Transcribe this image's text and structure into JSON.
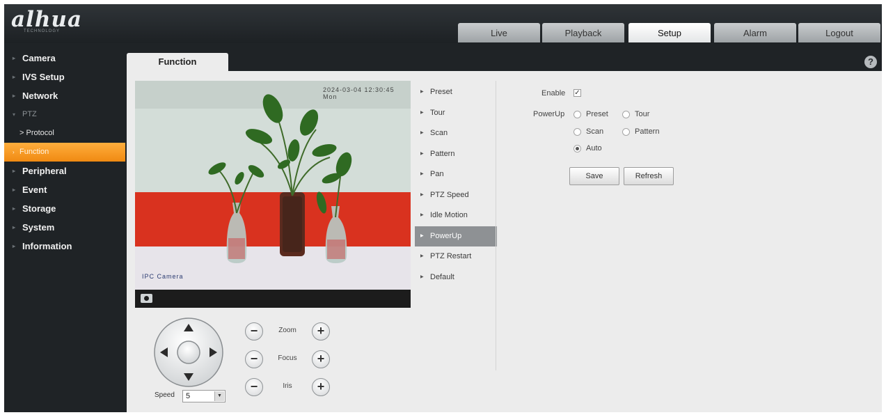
{
  "brand": {
    "logo": "alhua",
    "tagline": "TECHNOLOGY"
  },
  "nav_tabs": [
    {
      "label": "Live",
      "active": false
    },
    {
      "label": "Playback",
      "active": false
    },
    {
      "label": "Setup",
      "active": true
    },
    {
      "label": "Alarm",
      "active": false
    },
    {
      "label": "Logout",
      "active": false
    }
  ],
  "sidebar": {
    "items": [
      {
        "label": "Camera"
      },
      {
        "label": "IVS Setup"
      },
      {
        "label": "Network"
      },
      {
        "label": "PTZ"
      },
      {
        "label": "> Protocol"
      },
      {
        "label": "Function",
        "selected": true
      },
      {
        "label": "Peripheral"
      },
      {
        "label": "Event"
      },
      {
        "label": "Storage"
      },
      {
        "label": "System"
      },
      {
        "label": "Information"
      }
    ]
  },
  "content": {
    "tab_label": "Function",
    "help_icon": "?"
  },
  "video": {
    "osd_time": "2024-03-04 12:30:45 Mon",
    "osd_name": "IPC Camera"
  },
  "ptz": {
    "speed_label": "Speed",
    "speed_value": "5",
    "controls": [
      {
        "label": "Zoom",
        "minus": "−",
        "plus": "+"
      },
      {
        "label": "Focus",
        "minus": "−",
        "plus": "+"
      },
      {
        "label": "Iris",
        "minus": "−",
        "plus": "+"
      }
    ]
  },
  "function_list": [
    {
      "label": "Preset"
    },
    {
      "label": "Tour"
    },
    {
      "label": "Scan"
    },
    {
      "label": "Pattern"
    },
    {
      "label": "Pan"
    },
    {
      "label": "PTZ Speed"
    },
    {
      "label": "Idle Motion"
    },
    {
      "label": "PowerUp",
      "selected": true
    },
    {
      "label": "PTZ Restart"
    },
    {
      "label": "Default"
    }
  ],
  "powerup": {
    "enable_label": "Enable",
    "enable_checked": "✓",
    "powerup_label": "PowerUp",
    "options": {
      "preset": "Preset",
      "tour": "Tour",
      "scan": "Scan",
      "pattern": "Pattern",
      "auto": "Auto"
    },
    "selected_option": "Auto",
    "save_label": "Save",
    "refresh_label": "Refresh"
  },
  "colors": {
    "accent_orange": "#f59a1e",
    "header_dark": "#1f2326",
    "panel_gray": "#ececec",
    "wall_red": "#d9321f"
  }
}
